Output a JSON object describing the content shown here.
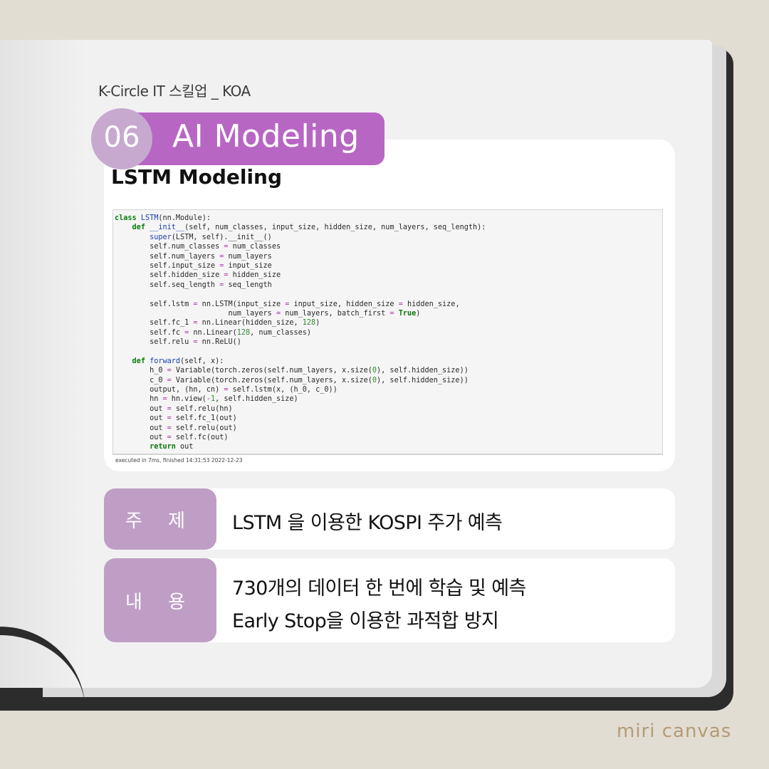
{
  "header": {
    "brand": "K-Circle IT 스킬업 _ KOA",
    "number": "06",
    "title": "AI Modeling"
  },
  "section": {
    "heading": "LSTM Modeling"
  },
  "code": {
    "lines": [
      [
        [
          "kw",
          "class "
        ],
        [
          "fn",
          "LSTM"
        ],
        [
          "t",
          "(nn.Module):"
        ]
      ],
      [
        [
          "t",
          "    "
        ],
        [
          "kw",
          "def "
        ],
        [
          "fn",
          "__init__"
        ],
        [
          "t",
          "(self, num_classes, input_size, hidden_size, num_layers, seq_length):"
        ]
      ],
      [
        [
          "t",
          "        "
        ],
        [
          "fn",
          "super"
        ],
        [
          "t",
          "(LSTM, self).__init__()"
        ]
      ],
      [
        [
          "t",
          "        self.num_classes "
        ],
        [
          "op",
          "="
        ],
        [
          "t",
          " num_classes"
        ]
      ],
      [
        [
          "t",
          "        self.num_layers "
        ],
        [
          "op",
          "="
        ],
        [
          "t",
          " num_layers"
        ]
      ],
      [
        [
          "t",
          "        self.input_size "
        ],
        [
          "op",
          "="
        ],
        [
          "t",
          " input_size"
        ]
      ],
      [
        [
          "t",
          "        self.hidden_size "
        ],
        [
          "op",
          "="
        ],
        [
          "t",
          " hidden_size"
        ]
      ],
      [
        [
          "t",
          "        self.seq_length "
        ],
        [
          "op",
          "="
        ],
        [
          "t",
          " seq_length"
        ]
      ],
      [
        [
          "t",
          ""
        ]
      ],
      [
        [
          "t",
          "        self.lstm "
        ],
        [
          "op",
          "="
        ],
        [
          "t",
          " nn.LSTM(input_size "
        ],
        [
          "op",
          "="
        ],
        [
          "t",
          " input_size, hidden_size "
        ],
        [
          "op",
          "="
        ],
        [
          "t",
          " hidden_size,"
        ]
      ],
      [
        [
          "t",
          "                          num_layers "
        ],
        [
          "op",
          "="
        ],
        [
          "t",
          " num_layers, batch_first "
        ],
        [
          "op",
          "="
        ],
        [
          "t",
          " "
        ],
        [
          "kw",
          "True"
        ],
        [
          "t",
          ")"
        ]
      ],
      [
        [
          "t",
          "        self.fc_1 "
        ],
        [
          "op",
          "="
        ],
        [
          "t",
          " nn.Linear(hidden_size, "
        ],
        [
          "num",
          "128"
        ],
        [
          "t",
          ")"
        ]
      ],
      [
        [
          "t",
          "        self.fc "
        ],
        [
          "op",
          "="
        ],
        [
          "t",
          " nn.Linear("
        ],
        [
          "num",
          "128"
        ],
        [
          "t",
          ", num_classes)"
        ]
      ],
      [
        [
          "t",
          "        self.relu "
        ],
        [
          "op",
          "="
        ],
        [
          "t",
          " nn.ReLU()"
        ]
      ],
      [
        [
          "t",
          ""
        ]
      ],
      [
        [
          "t",
          "    "
        ],
        [
          "kw",
          "def "
        ],
        [
          "fn",
          "forward"
        ],
        [
          "t",
          "(self, x):"
        ]
      ],
      [
        [
          "t",
          "        h_0 "
        ],
        [
          "op",
          "="
        ],
        [
          "t",
          " Variable(torch.zeros(self.num_layers, x.size("
        ],
        [
          "num",
          "0"
        ],
        [
          "t",
          "), self.hidden_size))"
        ]
      ],
      [
        [
          "t",
          "        c_0 "
        ],
        [
          "op",
          "="
        ],
        [
          "t",
          " Variable(torch.zeros(self.num_layers, x.size("
        ],
        [
          "num",
          "0"
        ],
        [
          "t",
          "), self.hidden_size))"
        ]
      ],
      [
        [
          "t",
          "        output, (hn, cn) "
        ],
        [
          "op",
          "="
        ],
        [
          "t",
          " self.lstm(x, (h_0, c_0))"
        ]
      ],
      [
        [
          "t",
          "        hn "
        ],
        [
          "op",
          "="
        ],
        [
          "t",
          " hn.view("
        ],
        [
          "op",
          "-"
        ],
        [
          "num",
          "1"
        ],
        [
          "t",
          ", self.hidden_size)"
        ]
      ],
      [
        [
          "t",
          "        out "
        ],
        [
          "op",
          "="
        ],
        [
          "t",
          " self.relu(hn)"
        ]
      ],
      [
        [
          "t",
          "        out "
        ],
        [
          "op",
          "="
        ],
        [
          "t",
          " self.fc_1(out)"
        ]
      ],
      [
        [
          "t",
          "        out "
        ],
        [
          "op",
          "="
        ],
        [
          "t",
          " self.relu(out)"
        ]
      ],
      [
        [
          "t",
          "        out "
        ],
        [
          "op",
          "="
        ],
        [
          "t",
          " self.fc(out)"
        ]
      ],
      [
        [
          "t",
          "        "
        ],
        [
          "kw",
          "return "
        ],
        [
          "t",
          "out"
        ]
      ]
    ],
    "status": "executed in 7ms, finished 14:31:53 2022-12-23"
  },
  "info": {
    "topic_label": "주 제",
    "topic_value": "LSTM 을 이용한 KOSPI 주가 예측",
    "content_label": "내 용",
    "content_line1": "730개의 데이터 한 번에 학습 및 예측",
    "content_line2": "Early Stop을 이용한 과적합 방지"
  },
  "watermark": "miri canvas",
  "colors": {
    "accent": "#b866c4",
    "accent_light": "#c7a9d0",
    "label_bg": "#bf9ec6",
    "background": "#e2ddd3",
    "cover": "#2c2c2c"
  }
}
